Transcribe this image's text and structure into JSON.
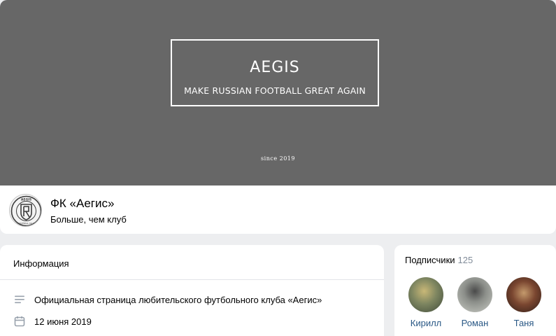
{
  "cover": {
    "title": "AEGIS",
    "subtitle": "MAKE RUSSIAN FOOTBALL GREAT AGAIN",
    "since": "since 2019",
    "background_color": "#676767"
  },
  "profile": {
    "name": "ФК «Аегис»",
    "status": "Больше, чем клуб",
    "avatar_icon": "club-logo-icon",
    "logo_text_top": "AEGIS",
    "logo_text_bottom": "FOOTBALL CLUB"
  },
  "info": {
    "title": "Информация",
    "description_icon": "list-icon",
    "description": "Официальная страница любительского футбольного клуба «Аегис»",
    "date_icon": "calendar-icon",
    "date": "12 июня 2019"
  },
  "subscribers": {
    "title": "Подписчики",
    "count": "125",
    "items": [
      {
        "name": "Кирилл",
        "color": "#6e7a5c"
      },
      {
        "name": "Роман",
        "color": "#8a8f8c"
      },
      {
        "name": "Таня",
        "color": "#6b4a3a"
      }
    ]
  },
  "colors": {
    "link": "#2a5885",
    "muted": "#818c99",
    "page_bg": "#edeef0"
  }
}
